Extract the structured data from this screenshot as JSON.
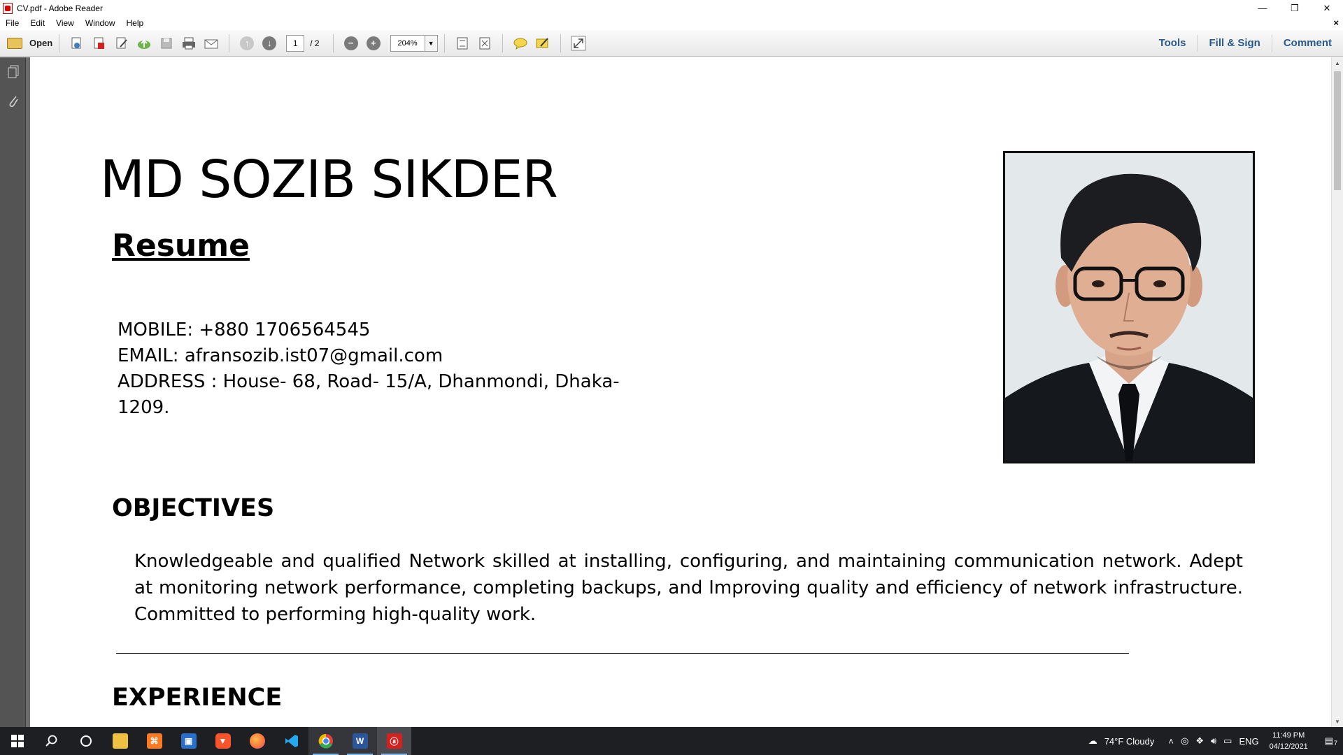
{
  "window": {
    "title": "CV.pdf - Adobe Reader",
    "controls": [
      "—",
      "❐",
      "✕"
    ]
  },
  "menu": {
    "items": [
      "File",
      "Edit",
      "View",
      "Window",
      "Help"
    ],
    "close": "×"
  },
  "toolbar": {
    "open_label": "Open",
    "current_page": "1",
    "total_pages": "/ 2",
    "zoom": "204%",
    "right_tabs": [
      "Tools",
      "Fill & Sign",
      "Comment"
    ]
  },
  "document": {
    "name": "MD SOZIB SIKDER",
    "resume_heading": "Resume",
    "mobile": "MOBILE: +880 1706564545",
    "email": "EMAIL: afransozib.ist07@gmail.com",
    "address_line1": "ADDRESS : House- 68, Road- 15/A, Dhanmondi, Dhaka-",
    "address_line2": "1209.",
    "objectives_heading": "OBJECTIVES",
    "objectives_text": "Knowledgeable and qualified Network skilled at installing, configuring, and maintaining communication network. Adept at monitoring network performance, completing backups, and Improving quality and efficiency of network infrastructure. Committed to performing high-quality work.",
    "experience_heading": "EXPERIENCE"
  },
  "taskbar": {
    "apps": [
      {
        "name": "start-button",
        "icon": "windows-icon"
      },
      {
        "name": "search-button",
        "icon": "search-icon"
      },
      {
        "name": "cortana-button",
        "icon": "circle-icon"
      },
      {
        "name": "file-explorer",
        "icon": "folder-icon",
        "color": "#f0c040"
      },
      {
        "name": "xampp",
        "icon": "xampp-icon",
        "color": "#fb7a24"
      },
      {
        "name": "teams",
        "icon": "app-icon",
        "color": "#2a6fc9"
      },
      {
        "name": "brave",
        "icon": "brave-icon",
        "color": "#fb542b"
      },
      {
        "name": "firefox",
        "icon": "firefox-icon",
        "color": "#ff7139"
      },
      {
        "name": "vscode",
        "icon": "vscode-icon",
        "color": "#23a9f2"
      },
      {
        "name": "chrome",
        "icon": "chrome-icon",
        "color": "#34a853"
      },
      {
        "name": "word",
        "icon": "word-icon",
        "color": "#2b579a",
        "letter": "W"
      },
      {
        "name": "adobe-reader",
        "icon": "pdf-icon",
        "color": "#d4201e"
      }
    ],
    "weather": "74°F  Cloudy",
    "language": "ENG",
    "time": "11:49 PM",
    "date": "04/12/2021",
    "notification_count": "7"
  }
}
